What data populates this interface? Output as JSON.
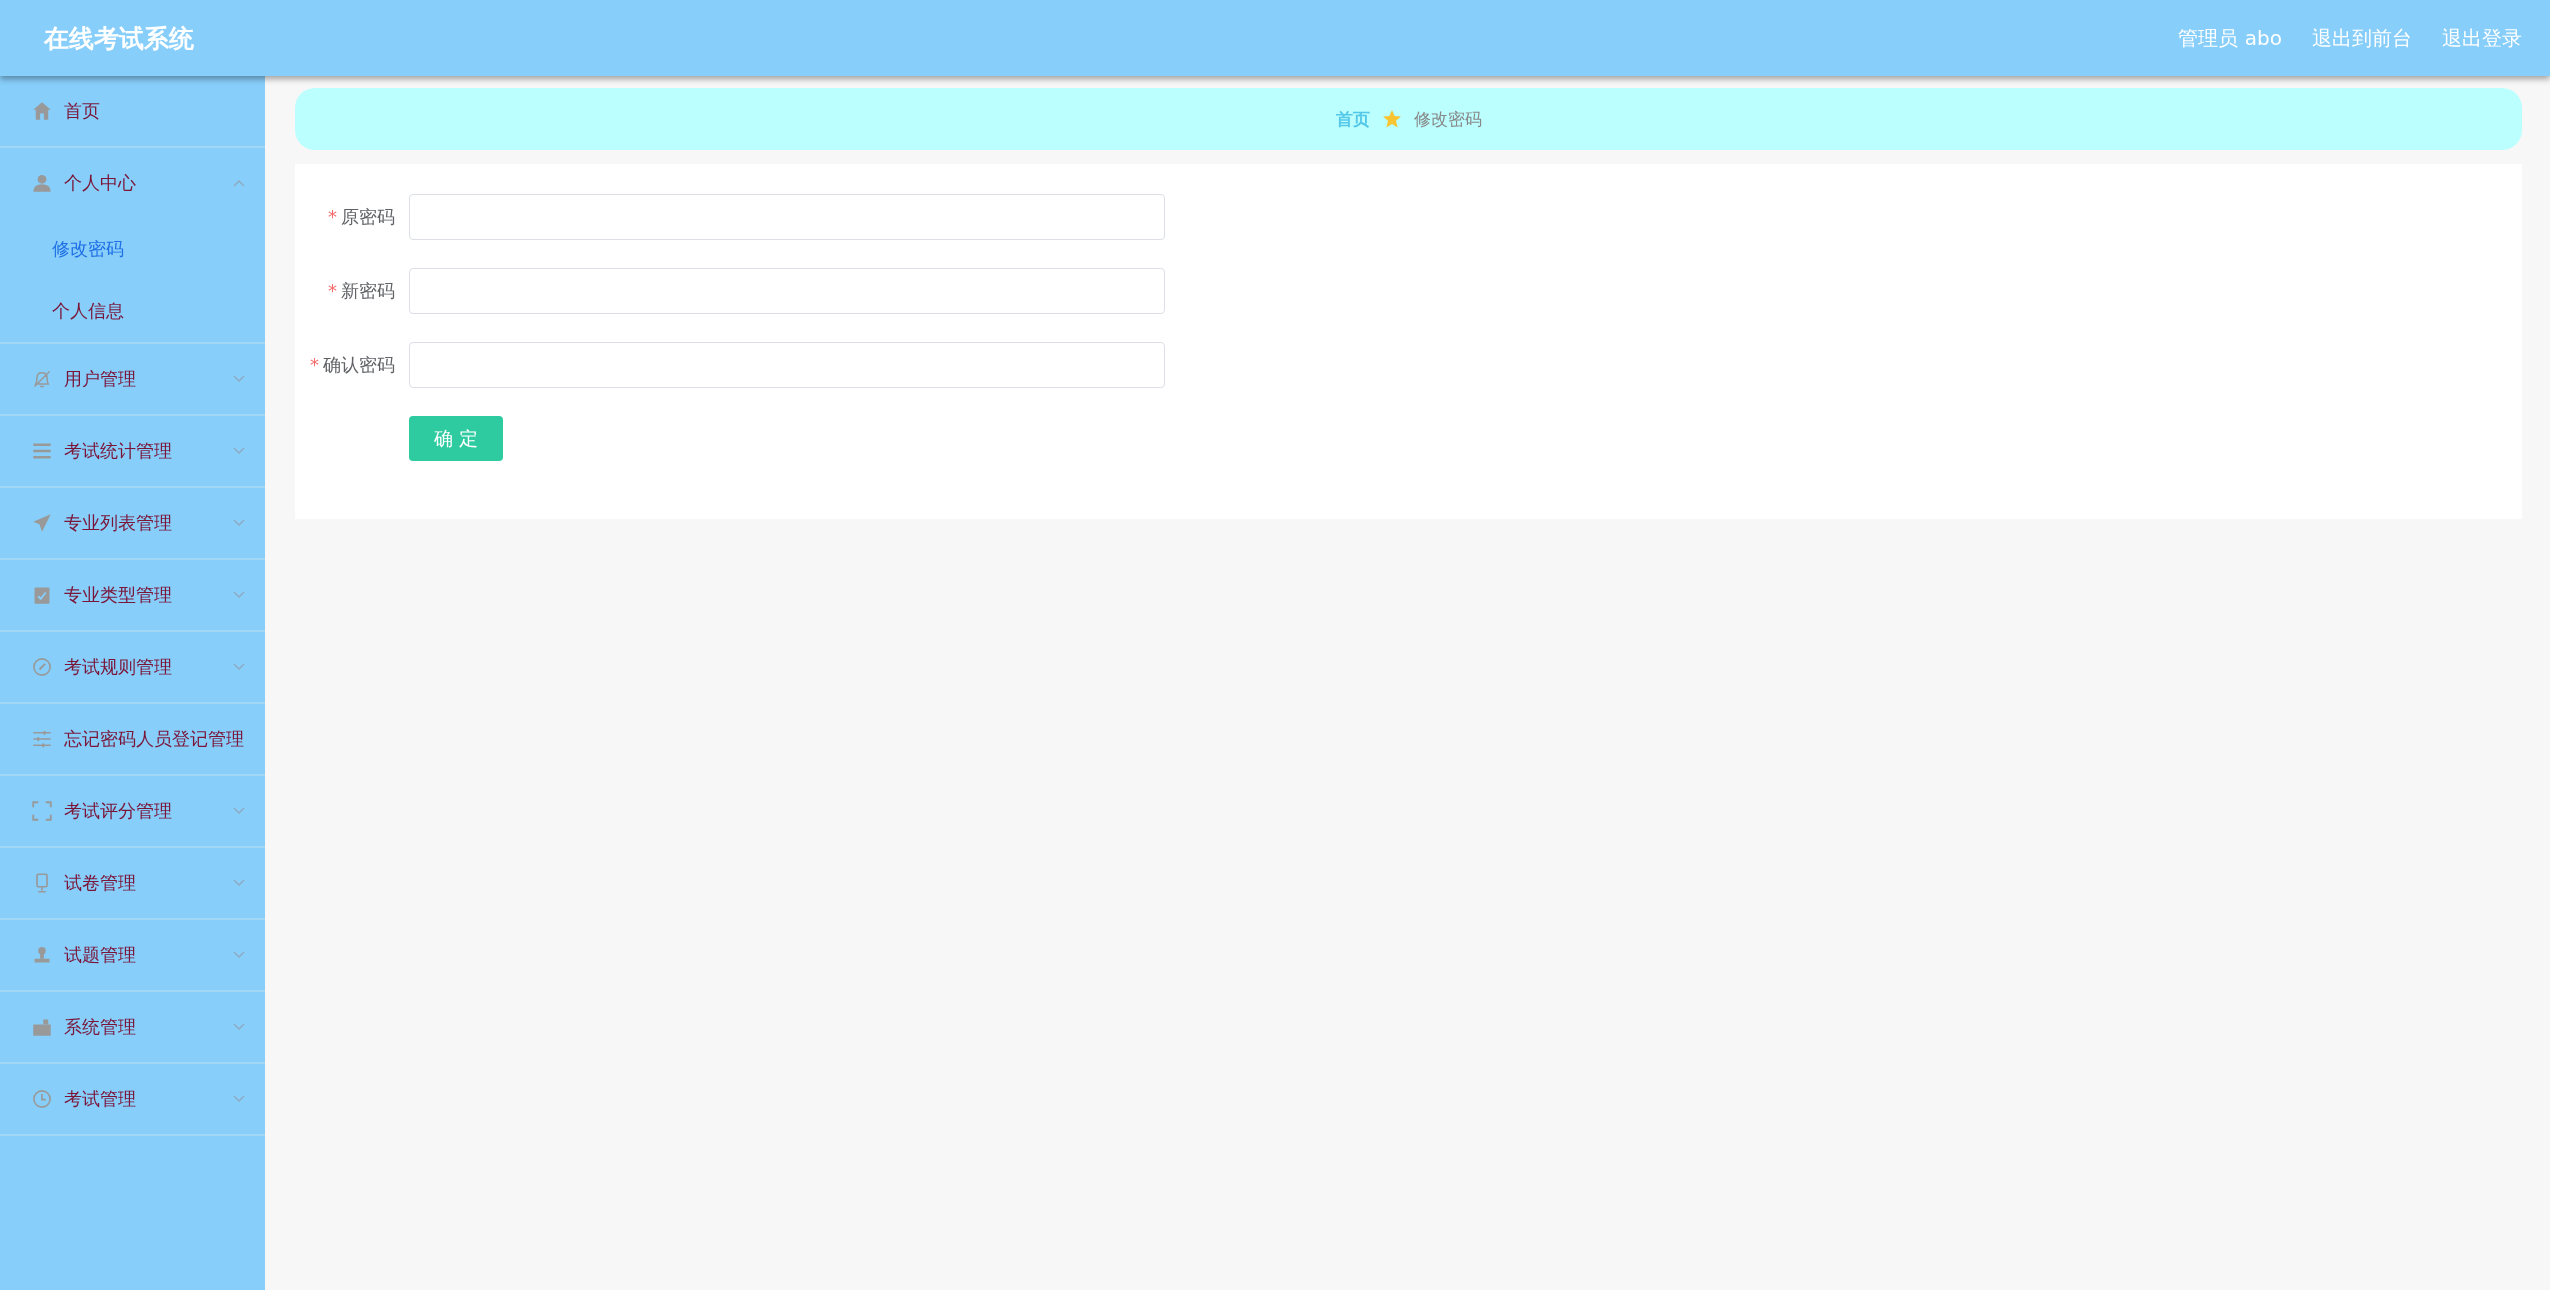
{
  "header": {
    "title": "在线考试系统",
    "user": "管理员 abo",
    "links": [
      "退出到前台",
      "退出登录"
    ]
  },
  "sidebar": {
    "items": [
      {
        "label": "首页",
        "kind": "link",
        "expanded": false
      },
      {
        "label": "个人中心",
        "kind": "submenu",
        "expanded": true,
        "children": [
          {
            "label": "修改密码",
            "selected": true
          },
          {
            "label": "个人信息",
            "selected": false
          }
        ]
      },
      {
        "label": "用户管理",
        "kind": "submenu",
        "expanded": false
      },
      {
        "label": "考试统计管理",
        "kind": "submenu",
        "expanded": false
      },
      {
        "label": "专业列表管理",
        "kind": "submenu",
        "expanded": false
      },
      {
        "label": "专业类型管理",
        "kind": "submenu",
        "expanded": false
      },
      {
        "label": "考试规则管理",
        "kind": "submenu",
        "expanded": false
      },
      {
        "label": "忘记密码人员登记管理",
        "kind": "link",
        "expanded": false
      },
      {
        "label": "考试评分管理",
        "kind": "submenu",
        "expanded": false
      },
      {
        "label": "试卷管理",
        "kind": "submenu",
        "expanded": false
      },
      {
        "label": "试题管理",
        "kind": "submenu",
        "expanded": false
      },
      {
        "label": "系统管理",
        "kind": "submenu",
        "expanded": false
      },
      {
        "label": "考试管理",
        "kind": "submenu",
        "expanded": false
      }
    ]
  },
  "breadcrumb": [
    "首页",
    "修改密码"
  ],
  "form": {
    "fields": [
      {
        "label": "原密码",
        "required_mark": "*"
      },
      {
        "label": "新密码",
        "required_mark": "*"
      },
      {
        "label": "确认密码",
        "required_mark": "*"
      }
    ],
    "submit": "确 定"
  }
}
